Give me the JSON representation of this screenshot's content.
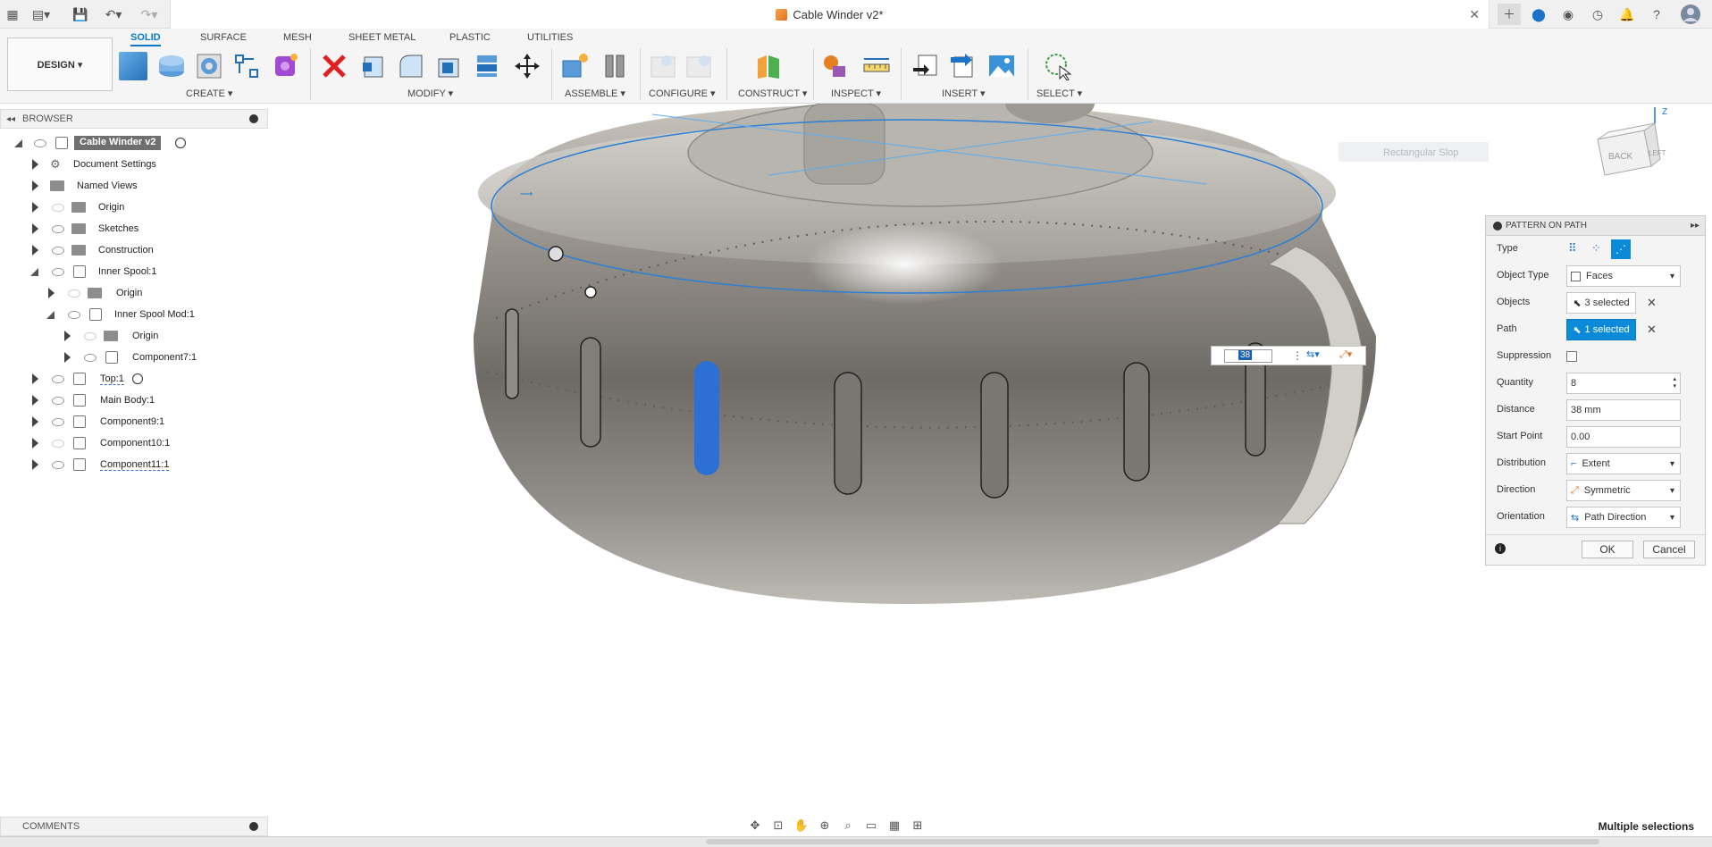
{
  "window": {
    "title": "Cable Winder v2*"
  },
  "toolbar": {
    "design_label": "DESIGN ▾",
    "tabs": [
      "SOLID",
      "SURFACE",
      "MESH",
      "SHEET METAL",
      "PLASTIC",
      "UTILITIES"
    ],
    "groups": {
      "create": "CREATE ▾",
      "modify": "MODIFY ▾",
      "assemble": "ASSEMBLE ▾",
      "configure": "CONFIGURE ▾",
      "construct": "CONSTRUCT ▾",
      "inspect": "INSPECT ▾",
      "insert": "INSERT ▾",
      "select": "SELECT ▾"
    }
  },
  "browser": {
    "title": "BROWSER",
    "items": [
      {
        "label": "Cable Winder v2"
      },
      {
        "label": "Document Settings"
      },
      {
        "label": "Named Views"
      },
      {
        "label": "Origin"
      },
      {
        "label": "Sketches"
      },
      {
        "label": "Construction"
      },
      {
        "label": "Inner Spool:1"
      },
      {
        "label": "Origin"
      },
      {
        "label": "Inner Spool Mod:1"
      },
      {
        "label": "Origin"
      },
      {
        "label": "Component7:1"
      },
      {
        "label": "Top:1"
      },
      {
        "label": "Main Body:1"
      },
      {
        "label": "Component9:1"
      },
      {
        "label": "Component10:1"
      },
      {
        "label": "Component11:1"
      }
    ]
  },
  "canvas": {
    "dim_value": "38",
    "viewcube": {
      "back": "BACK",
      "left": "LEFT",
      "axis": "Z"
    },
    "ghost_label": "Rectangular Slop"
  },
  "pattern_panel": {
    "title": "PATTERN ON PATH",
    "rows": {
      "type": "Type",
      "object_type": {
        "label": "Object Type",
        "value": "Faces"
      },
      "objects": {
        "label": "Objects",
        "value": "3 selected"
      },
      "path": {
        "label": "Path",
        "value": "1 selected"
      },
      "suppression": {
        "label": "Suppression"
      },
      "quantity": {
        "label": "Quantity",
        "value": "8"
      },
      "distance": {
        "label": "Distance",
        "value": "38 mm"
      },
      "start_point": {
        "label": "Start Point",
        "value": "0.00"
      },
      "distribution": {
        "label": "Distribution",
        "value": "Extent"
      },
      "direction": {
        "label": "Direction",
        "value": "Symmetric"
      },
      "orientation": {
        "label": "Orientation",
        "value": "Path Direction"
      }
    },
    "ok_label": "OK",
    "cancel_label": "Cancel"
  },
  "comments": {
    "title": "COMMENTS"
  },
  "status": {
    "text": "Multiple selections"
  },
  "colors": {
    "accent": "#0a79c8",
    "selection_blue": "#2e6fd6"
  }
}
